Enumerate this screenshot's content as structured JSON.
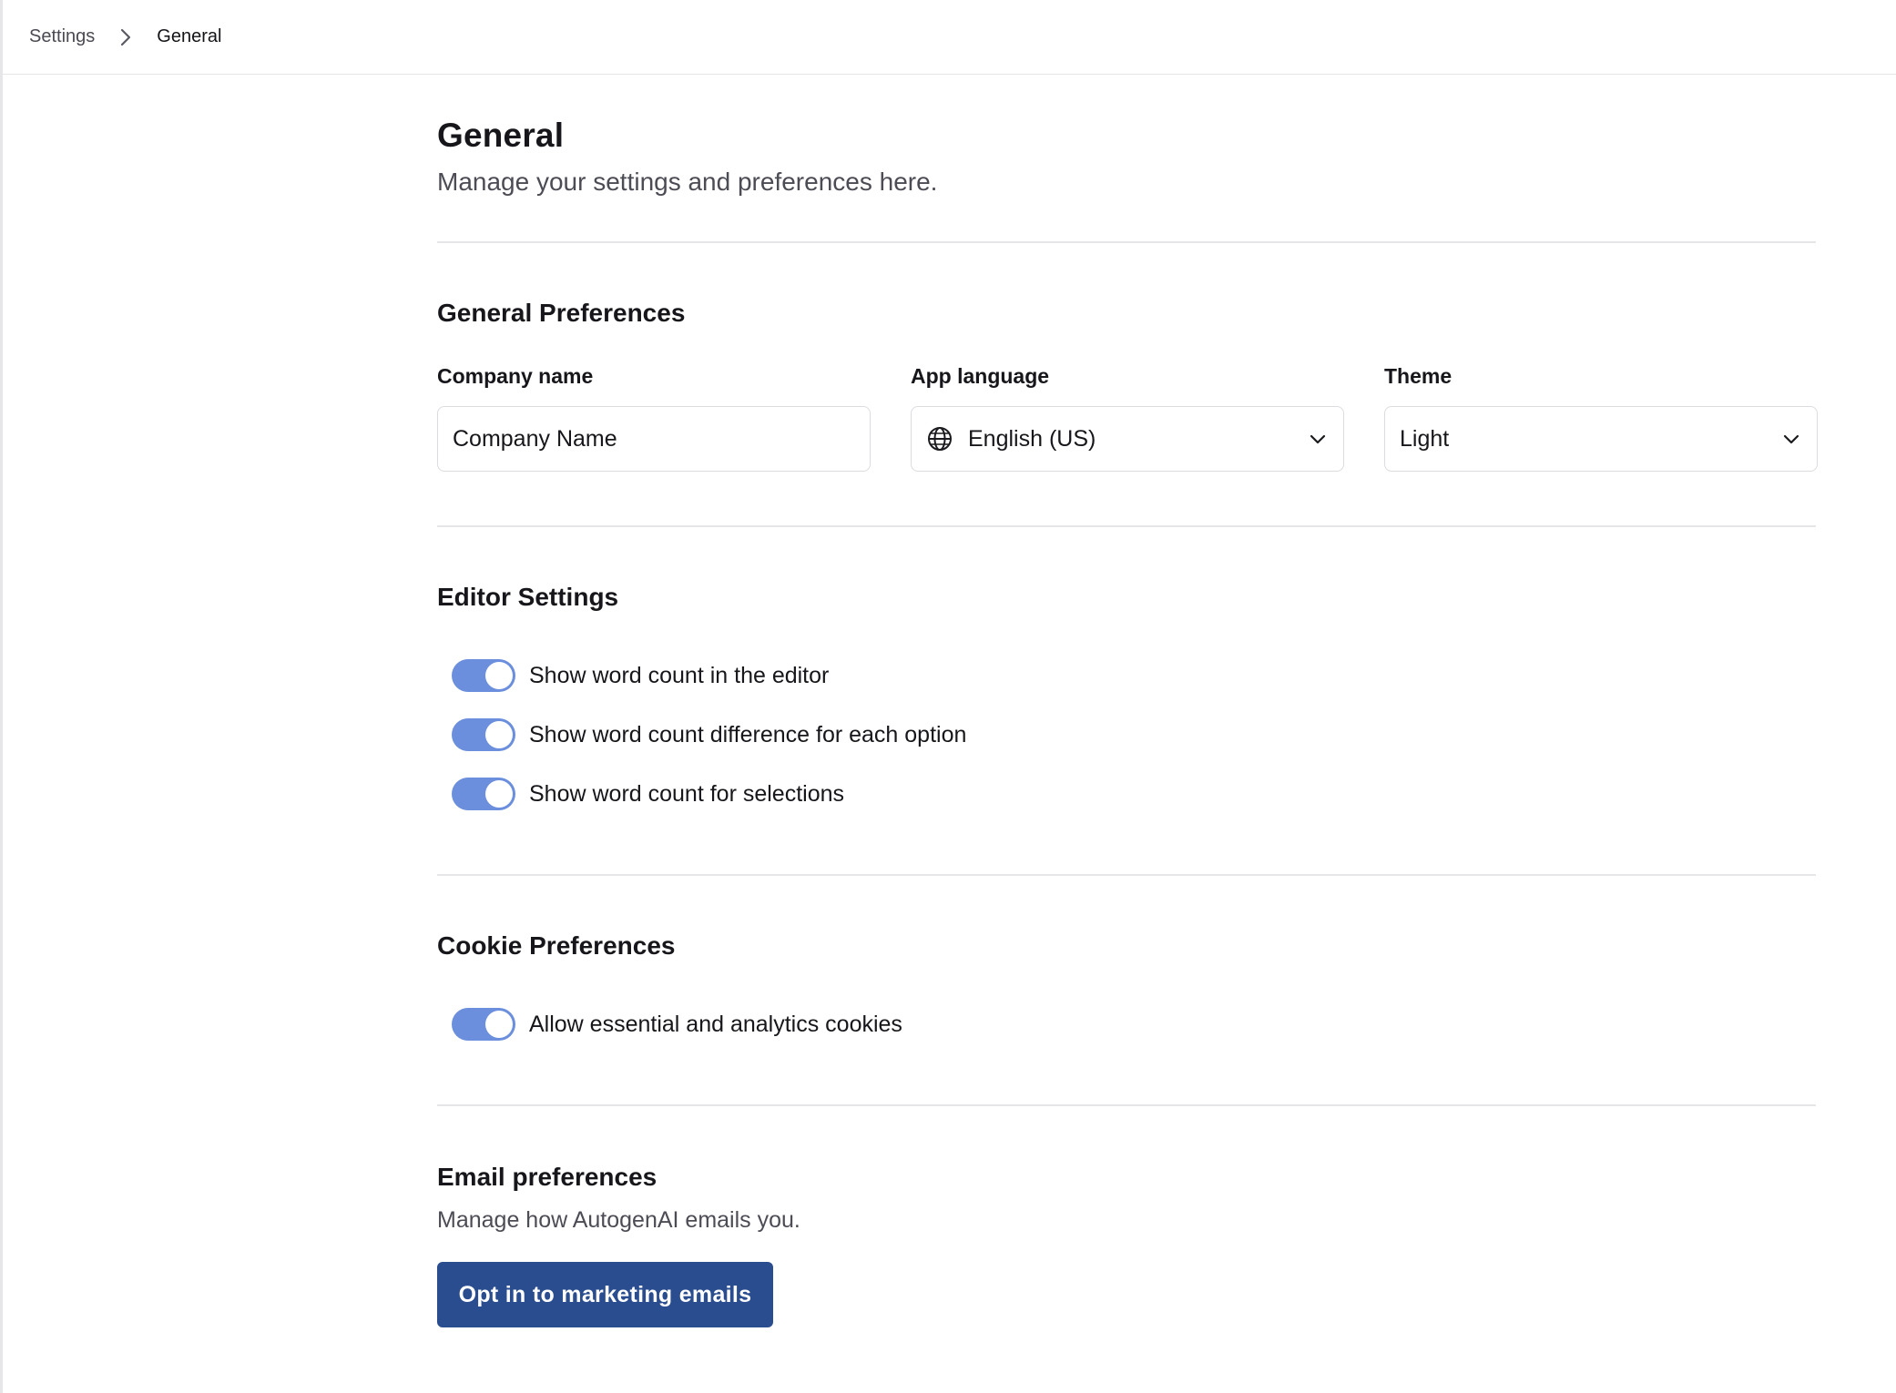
{
  "breadcrumb": {
    "root": "Settings",
    "current": "General"
  },
  "page": {
    "title": "General",
    "subtitle": "Manage your settings and preferences here."
  },
  "general_preferences": {
    "title": "General Preferences",
    "company_name": {
      "label": "Company name",
      "value": "Company Name"
    },
    "app_language": {
      "label": "App language",
      "value": "English (US)"
    },
    "theme": {
      "label": "Theme",
      "value": "Light"
    }
  },
  "editor_settings": {
    "title": "Editor Settings",
    "toggles": [
      {
        "label": "Show word count in the editor",
        "on": true
      },
      {
        "label": "Show word count difference for each option",
        "on": true
      },
      {
        "label": "Show word count for selections",
        "on": true
      }
    ]
  },
  "cookie_preferences": {
    "title": "Cookie Preferences",
    "toggles": [
      {
        "label": "Allow essential and analytics cookies",
        "on": true
      }
    ]
  },
  "email_preferences": {
    "title": "Email preferences",
    "description": "Manage how AutogenAI emails you.",
    "button_label": "Opt in to marketing emails"
  },
  "colors": {
    "toggle_on": "#6b8fdc",
    "primary_button": "#2a4d8f",
    "divider": "#e6e6e8"
  },
  "icons": {
    "breadcrumb_separator": "chevron-right-icon",
    "language": "globe-icon",
    "dropdown": "chevron-down-icon"
  }
}
